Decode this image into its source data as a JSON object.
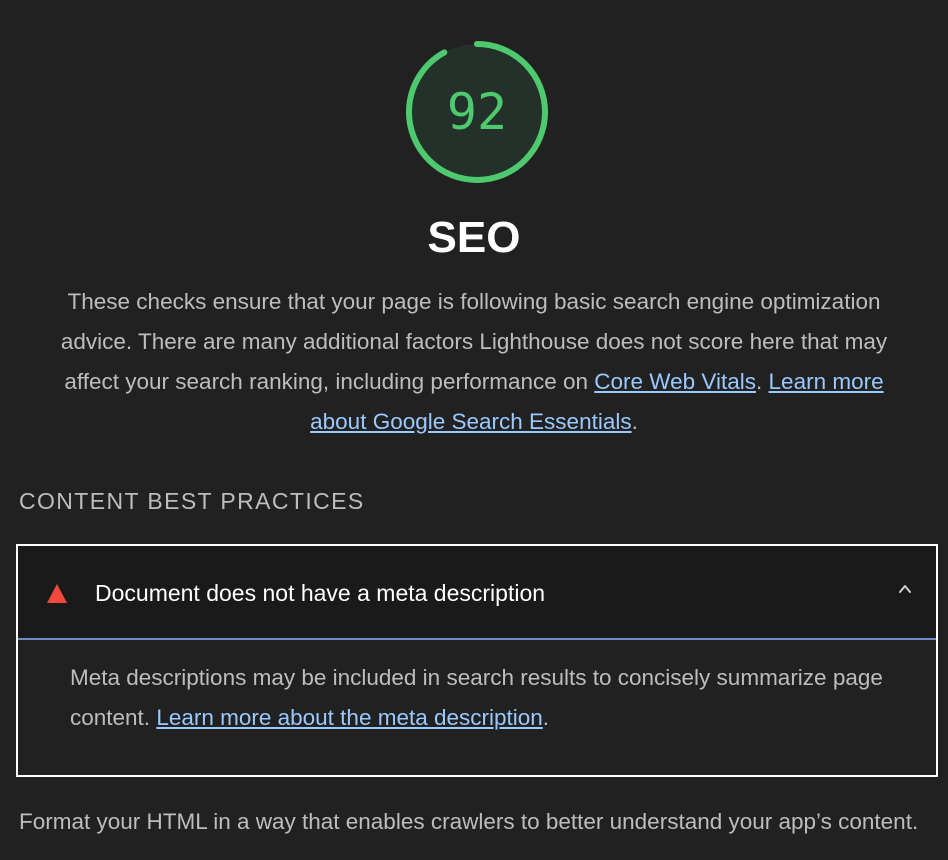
{
  "score": {
    "value": "92",
    "fraction": 0.92,
    "color": "#4fc96d"
  },
  "category": {
    "title": "SEO",
    "description": "These checks ensure that your page is following basic search engine optimization advice. There are many additional factors Lighthouse does not score here that may affect your search ranking, including performance on ",
    "link1": "Core Web Vitals",
    "sep": ". ",
    "link2": "Learn more about Google Search Essentials",
    "end": "."
  },
  "group": {
    "title": "CONTENT BEST PRACTICES",
    "description": "Format your HTML in a way that enables crawlers to better understand your app’s content."
  },
  "audit": {
    "title": "Document does not have a meta description",
    "status_icon": "fail-triangle-icon",
    "status_color": "#f04a3e",
    "expanded": true,
    "body_text": "Meta descriptions may be included in search results to concisely summarize page content. ",
    "body_link": "Learn more about the meta description",
    "body_end": "."
  }
}
